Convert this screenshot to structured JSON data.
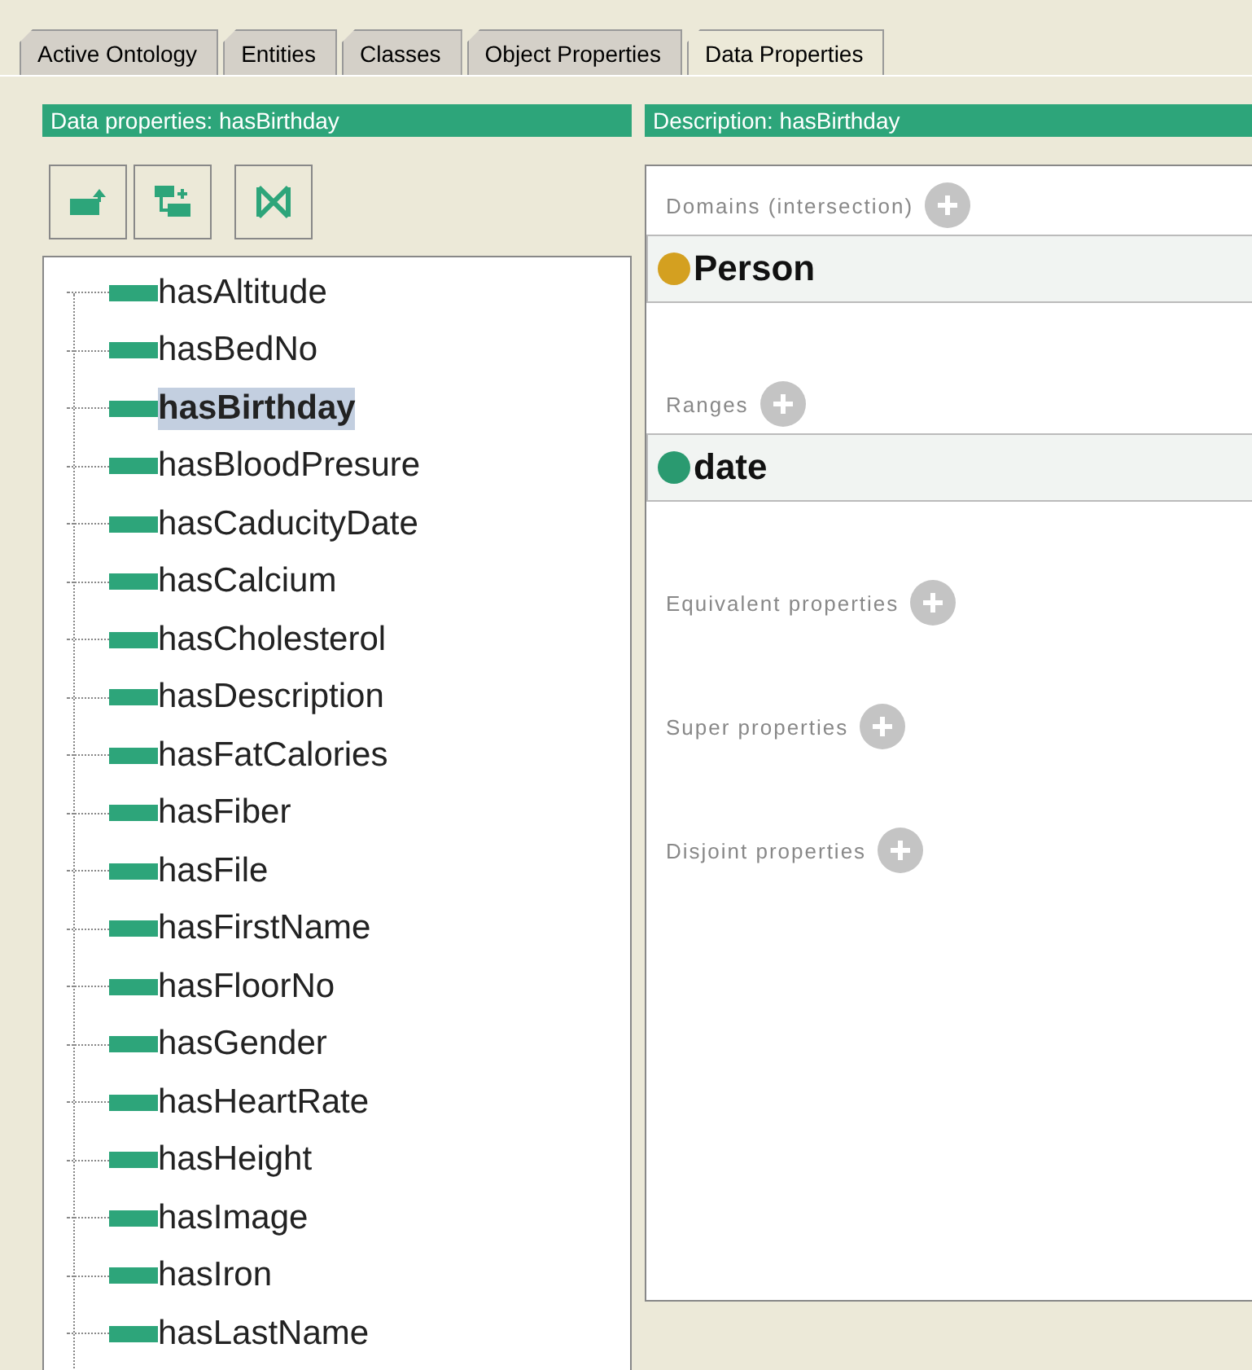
{
  "tabs": [
    {
      "label": "Active Ontology",
      "selected": false
    },
    {
      "label": "Entities",
      "selected": false
    },
    {
      "label": "Classes",
      "selected": false
    },
    {
      "label": "Object Properties",
      "selected": false
    },
    {
      "label": "Data Properties",
      "selected": true
    }
  ],
  "hierarchy": {
    "title": "Data properties: hasBirthday",
    "tools": [
      {
        "kind": "add-sub"
      },
      {
        "kind": "add-sibling"
      },
      {
        "kind": "delete"
      }
    ],
    "items": [
      {
        "label": "hasAltitude",
        "selected": false
      },
      {
        "label": "hasBedNo",
        "selected": false
      },
      {
        "label": "hasBirthday",
        "selected": true
      },
      {
        "label": "hasBloodPresure",
        "selected": false
      },
      {
        "label": "hasCaducityDate",
        "selected": false
      },
      {
        "label": "hasCalcium",
        "selected": false
      },
      {
        "label": "hasCholesterol",
        "selected": false
      },
      {
        "label": "hasDescription",
        "selected": false
      },
      {
        "label": "hasFatCalories",
        "selected": false
      },
      {
        "label": "hasFiber",
        "selected": false
      },
      {
        "label": "hasFile",
        "selected": false
      },
      {
        "label": "hasFirstName",
        "selected": false
      },
      {
        "label": "hasFloorNo",
        "selected": false
      },
      {
        "label": "hasGender",
        "selected": false
      },
      {
        "label": "hasHeartRate",
        "selected": false
      },
      {
        "label": "hasHeight",
        "selected": false
      },
      {
        "label": "hasImage",
        "selected": false
      },
      {
        "label": "hasIron",
        "selected": false
      },
      {
        "label": "hasLastName",
        "selected": false
      }
    ]
  },
  "description": {
    "title": "Description: hasBirthday",
    "sections": [
      {
        "label": "Domains (intersection)",
        "items": [
          {
            "label": "Person",
            "color": "#d4a020"
          }
        ]
      },
      {
        "label": "Ranges",
        "items": [
          {
            "label": "date",
            "color": "#2a9a70"
          }
        ]
      },
      {
        "label": "Equivalent properties"
      },
      {
        "label": "Super properties"
      },
      {
        "label": "Disjoint properties"
      }
    ]
  }
}
